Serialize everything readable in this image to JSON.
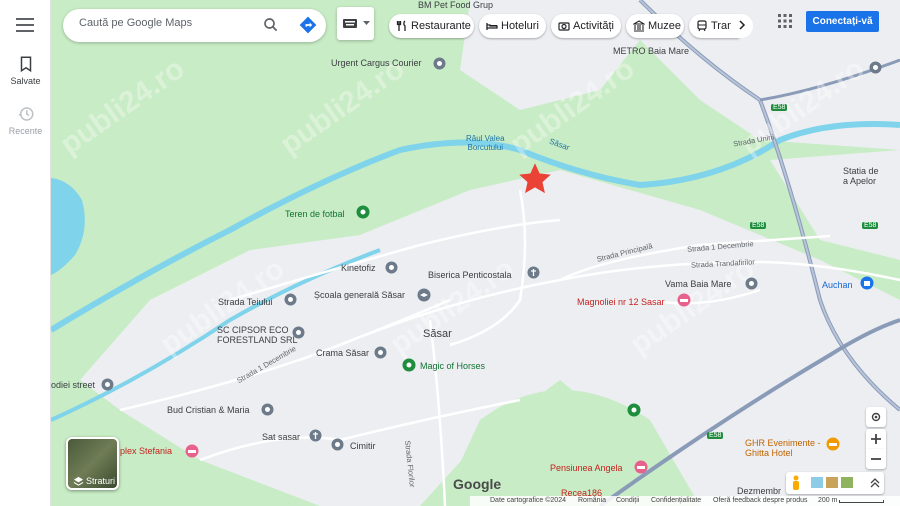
{
  "sidebar": {
    "items": [
      {
        "label": "Salvate"
      },
      {
        "label": "Recente"
      }
    ]
  },
  "search": {
    "placeholder": "Caută pe Google Maps"
  },
  "chips": [
    {
      "label": "Restaurante",
      "icon": "fork-knife-icon"
    },
    {
      "label": "Hoteluri",
      "icon": "bed-icon"
    },
    {
      "label": "Activități",
      "icon": "camera-icon"
    },
    {
      "label": "Muzee",
      "icon": "museum-icon"
    },
    {
      "label": "Trans",
      "icon": "transit-icon"
    }
  ],
  "header": {
    "signin_label": "Conectați-vă"
  },
  "map": {
    "labels": {
      "bm_pet": "BM Pet Food Grup",
      "urgent_cargus": "Urgent Cargus Courier",
      "metro": "METRO Baia Mare",
      "raul": "Râul Valea\nBorcutului",
      "sasar_river": "Săsar",
      "str_unirii": "Strada Unirii",
      "statia": "Statia de\na Apelor",
      "teren": "Teren de fotbal",
      "kinetofiz": "Kinetofiz",
      "biserica": "Biserica Penticostala",
      "str_principala": "Strada Principală",
      "str_1dec_top": "Strada 1 Decembrie",
      "str_trandafirilor": "Strada Trandafirilor",
      "strada_teiului": "Strada Teiului",
      "scoala": "Școala generală Săsar",
      "magnoliei": "Magnoliei nr 12 Sasar",
      "vama": "Vama Baia Mare",
      "auchan": "Auchan",
      "sc_cipsor": "SC CIPSOR ECO\nFORESTLAND SRL",
      "sasar_town": "Săsar",
      "crama": "Crama Săsar",
      "str_1dec_left": "Strada 1 Decembrie",
      "magic": "Magic of Horses",
      "odiei": "odiei street",
      "bud": "Bud Cristian & Maria",
      "sat_sasar": "Sat sasar",
      "cimitir": "Cimitir",
      "stefania": "plex Stefania",
      "strada_florilor": "Strada Florilor",
      "ghr": "GHR Evenimente -\nGhitta Hotel",
      "pensiunea": "Pensiunea Angela",
      "recea": "Recea186",
      "dezmembr": "Dezmembr",
      "e58_a": "E58",
      "e58_b": "E58",
      "e58_c": "E58",
      "e58_d": "E58",
      "watermark": "publi24.ro"
    }
  },
  "layers": {
    "label": "Straturi"
  },
  "footer": {
    "data": "Date cartografice ©2024",
    "country": "România",
    "terms": "Condiții",
    "privacy": "Confidențialitate",
    "feedback": "Oferă feedback despre produs",
    "scale": "200 m"
  },
  "logo": "Google",
  "colors": {
    "park": "#c8ecc5",
    "urban": "#eceef2",
    "water": "#7fd3ea",
    "road": "#ffffff",
    "highway": "#8a9bb8",
    "marker": "#ea4335",
    "accent": "#1a73e8"
  }
}
